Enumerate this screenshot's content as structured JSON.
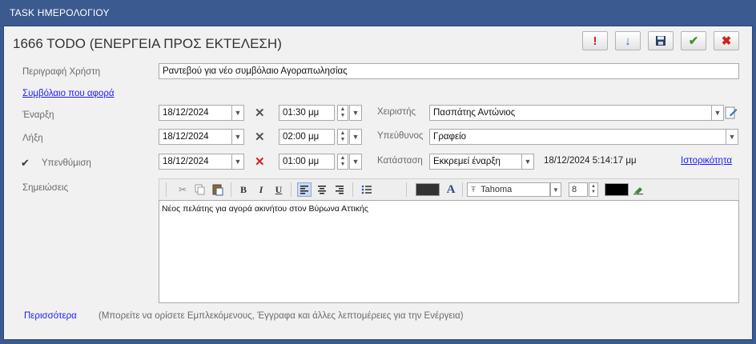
{
  "window": {
    "title": "TASK ΗΜΕΡΟΛΟΓΙΟΥ"
  },
  "header": {
    "title": "1666 TODO (ΕΝΕΡΓΕΙΑ ΠΡΟΣ ΕΚΤΕΛΕΣΗ)"
  },
  "toolbar": {
    "priority_icon": "!",
    "down_icon": "↓",
    "save_icon": "💾",
    "ok_icon": "✔",
    "cancel_icon": "✖",
    "colors": {
      "priority": "#d32020",
      "down": "#2a6fc9",
      "ok": "#3a9a2a",
      "cancel": "#d32020"
    }
  },
  "form": {
    "user_desc_label": "Περιγραφή Χρήστη",
    "user_desc_value": "Ραντεβού για νέο συμβόλαιο Αγοραπωλησίας",
    "contract_link": "Συμβόλαιο που αφορά",
    "start_label": "Έναρξη",
    "start_date": "18/12/2024",
    "start_time": "01:30 μμ",
    "end_label": "Λήξη",
    "end_date": "18/12/2024",
    "end_time": "02:00 μμ",
    "reminder_label": "Υπενθύμιση",
    "reminder_checked": "✔",
    "reminder_date": "18/12/2024",
    "reminder_time": "01:00 μμ",
    "handler_label": "Χειριστής",
    "handler_value": "Πασπάτης Αντώνιος",
    "responsible_label": "Υπεύθυνος",
    "responsible_value": "Γραφείο",
    "status_label": "Κατάσταση",
    "status_value": "Εκκρεμεί έναρξη",
    "status_timestamp": "18/12/2024 5:14:17 μμ",
    "history_link": "Ιστορικότητα",
    "notes_label": "Σημειώσεις"
  },
  "editor": {
    "font_name": "Tahoma",
    "font_size": "8",
    "bold": "B",
    "italic": "I",
    "underline": "U",
    "text_color_glyph": "A",
    "content": "Νέος πελάτης για αγορά ακινήτου στον  Βύρωνα Αττικής"
  },
  "footer": {
    "more_link": "Περισσότερα",
    "hint": "(Μπορείτε να ορίσετε Εμπλεκόμενους, Έγγραφα και άλλες λεπτομέρειες για την Ενέργεια)"
  }
}
